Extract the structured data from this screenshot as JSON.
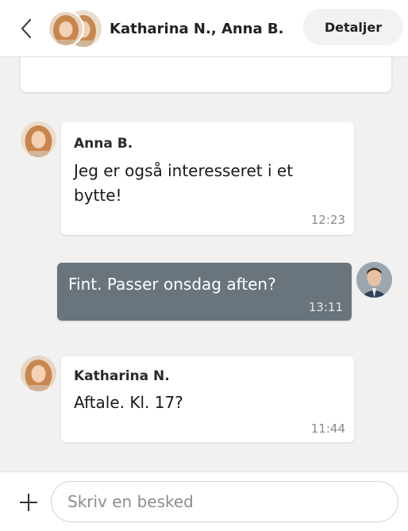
{
  "header": {
    "title": "Katharina N., Anna B.",
    "details_label": "Detaljer"
  },
  "messages": [
    {
      "sender": "Anna B.",
      "text": "Jeg er også interesseret i et bytte!",
      "time": "12:23",
      "own": false
    },
    {
      "sender": "",
      "text": "Fint. Passer onsdag aften?",
      "time": "13:11",
      "own": true
    },
    {
      "sender": "Katharina N.",
      "text": "Aftale. Kl. 17?",
      "time": "11:44",
      "own": false
    }
  ],
  "composer": {
    "placeholder": "Skriv en besked"
  },
  "colors": {
    "own_bubble": "#6a747c",
    "background": "#f1f1f1"
  },
  "icons": [
    "chevron-left-icon",
    "plus-icon"
  ]
}
